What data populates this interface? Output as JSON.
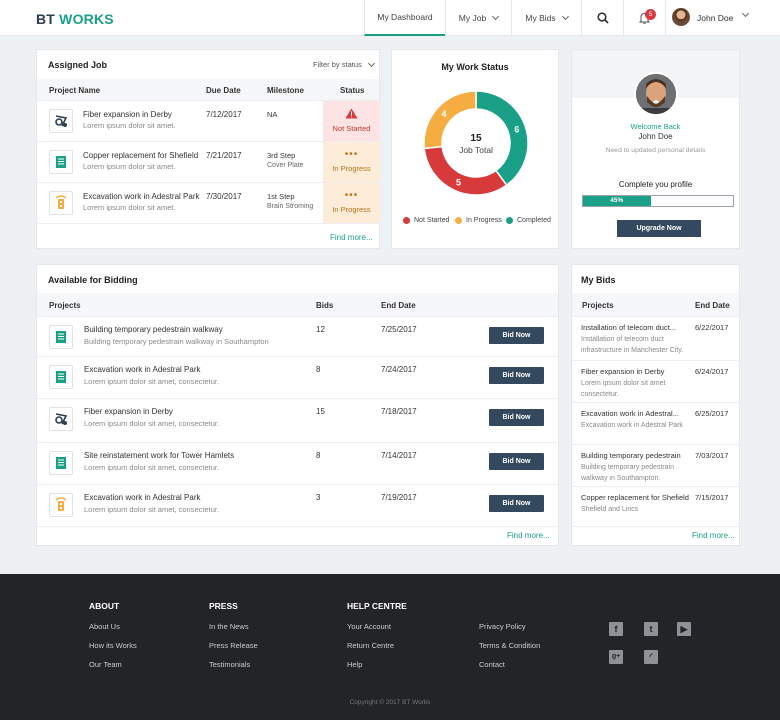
{
  "brand": {
    "part1": "BT",
    "part2": "WORKS"
  },
  "nav": {
    "dashboard": "My Dashboard",
    "job": "My Job",
    "bids": "My Bids",
    "notifications_count": "5",
    "user": "John Doe"
  },
  "assigned": {
    "title": "Assigned Job",
    "filter": "Filter by status",
    "headers": {
      "project": "Project Name",
      "due": "Due Date",
      "milestone": "Milestone",
      "status": "Status"
    },
    "rows": [
      {
        "title": "Fiber expansion in  Derby",
        "desc": "Lorem ipsum dolor sit amet.",
        "due": "7/12/2017",
        "milestone": "NA",
        "milestone_sub": "",
        "status": "Not Started",
        "icon": "cable-reel-icon"
      },
      {
        "title": "Copper replacement for Shefield",
        "desc": "Lorem ipsum dolor sit amet.",
        "due": "7/21/2017",
        "milestone": "3rd Step",
        "milestone_sub": "Cover Plate",
        "status": "In Progress",
        "icon": "document-list-icon"
      },
      {
        "title": "Excavation work in Adestral Park",
        "desc": "Lorem ipsum dolor sit amet.",
        "due": "7/30/2017",
        "milestone": "1st Step",
        "milestone_sub": "Brain Stroming",
        "status": "In Progress",
        "icon": "traffic-light-icon"
      }
    ],
    "find_more": "Find more..."
  },
  "work_status": {
    "title": "My Work Status",
    "total": "15",
    "total_label": "Job Total",
    "segments": [
      {
        "label": "Not Started",
        "value": 5,
        "color": "#d63a3a"
      },
      {
        "label": "In Progress",
        "value": 4,
        "color": "#f5ad42"
      },
      {
        "label": "Completed",
        "value": 6,
        "color": "#1aa086"
      }
    ],
    "legend": [
      "Not Started",
      "In Progress",
      "Completed"
    ]
  },
  "profile": {
    "welcome": "Welcome Back",
    "name": "John Doe",
    "hint": "Need to updated personal details",
    "complete_label": "Complete you profile",
    "progress": 45,
    "progress_text": "45%",
    "upgrade": "Upgrade Now"
  },
  "bidding": {
    "title": "Available for Bidding",
    "headers": {
      "projects": "Projects",
      "bids": "Bids",
      "end": "End Date"
    },
    "button": "Bid Now",
    "rows": [
      {
        "title": "Building temporary pedestrain walkway",
        "desc": "Building temporary pedestrain walkway in Southampton",
        "bids": "12",
        "end": "7/25/2017",
        "icon": "document-list-icon"
      },
      {
        "title": "Excavation work in Adestral Park",
        "desc": "Lorem ipsum dolor sit amet, consectetur.",
        "bids": "8",
        "end": "7/24/2017",
        "icon": "document-list-icon"
      },
      {
        "title": "Fiber expansion in  Derby",
        "desc": "Lorem ipsum dolor sit amet, consectetur.",
        "bids": "15",
        "end": "7/18/2017",
        "icon": "cable-reel-icon"
      },
      {
        "title": "Site reinstatement work for Tower Hamlets",
        "desc": "Lorem ipsum dolor sit amet, consectetur.",
        "bids": "8",
        "end": "7/14/2017",
        "icon": "document-list-icon"
      },
      {
        "title": "Excavation work in Adestral Park",
        "desc": "Lorem ipsum dolor sit amet, consectetur.",
        "bids": "3",
        "end": "7/19/2017",
        "icon": "traffic-light-icon"
      }
    ],
    "find_more": "Find more..."
  },
  "mybids": {
    "title": "My Bids",
    "headers": {
      "projects": "Projects",
      "end": "End Date"
    },
    "rows": [
      {
        "title": "Installation of telecom duct...",
        "desc": "Installation of telecom duct infrastructure in Manchester City.",
        "end": "6/22/2017"
      },
      {
        "title": "Fiber expansion in  Derby",
        "desc": "Lorem ipsum dolor sit amet consectetur.",
        "end": "6/24/2017"
      },
      {
        "title": "Excavation work in Adestral...",
        "desc": "Excavation work in Adestral Park",
        "end": "6/25/2017"
      },
      {
        "title": "Building temporary pedestrain",
        "desc": "Building temporary pedestrain walkway in Southampton.",
        "end": "7/03/2017"
      },
      {
        "title": "Copper replacement for Shefield",
        "desc": "Shefield and Lincs",
        "end": "7/15/2017"
      }
    ],
    "find_more": "Find more..."
  },
  "footer": {
    "about": {
      "heading": "ABOUT",
      "links": [
        "About Us",
        "How its Works",
        "Our Team"
      ]
    },
    "press": {
      "heading": "PRESS",
      "links": [
        "In the News",
        "Press Release",
        "Testimonials"
      ]
    },
    "help": {
      "heading": "HELP CENTRE",
      "links": [
        "Your Account",
        "Return Centre",
        "Help"
      ]
    },
    "legal": {
      "links": [
        "Privacy Policy",
        "Terms & Condition",
        "Contact"
      ]
    },
    "social": [
      "facebook-icon",
      "twitter-icon",
      "youtube-icon",
      "google-plus-icon",
      "rss-icon"
    ],
    "copyright": "Copyright © 2017 BT Works"
  }
}
